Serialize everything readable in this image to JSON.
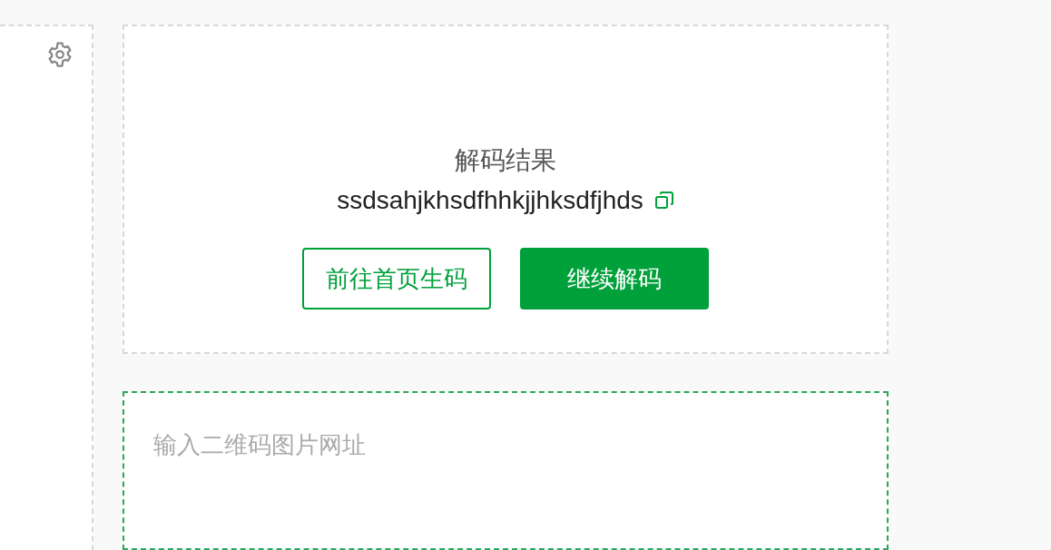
{
  "result": {
    "title": "解码结果",
    "value": "ssdsahjkhsdfhhkjjhksdfjhds"
  },
  "buttons": [
    {
      "label": "前往首页生码",
      "kind": "outline"
    },
    {
      "label": "继续解码",
      "kind": "primary"
    }
  ],
  "url_input": {
    "placeholder": "输入二维码图片网址"
  }
}
